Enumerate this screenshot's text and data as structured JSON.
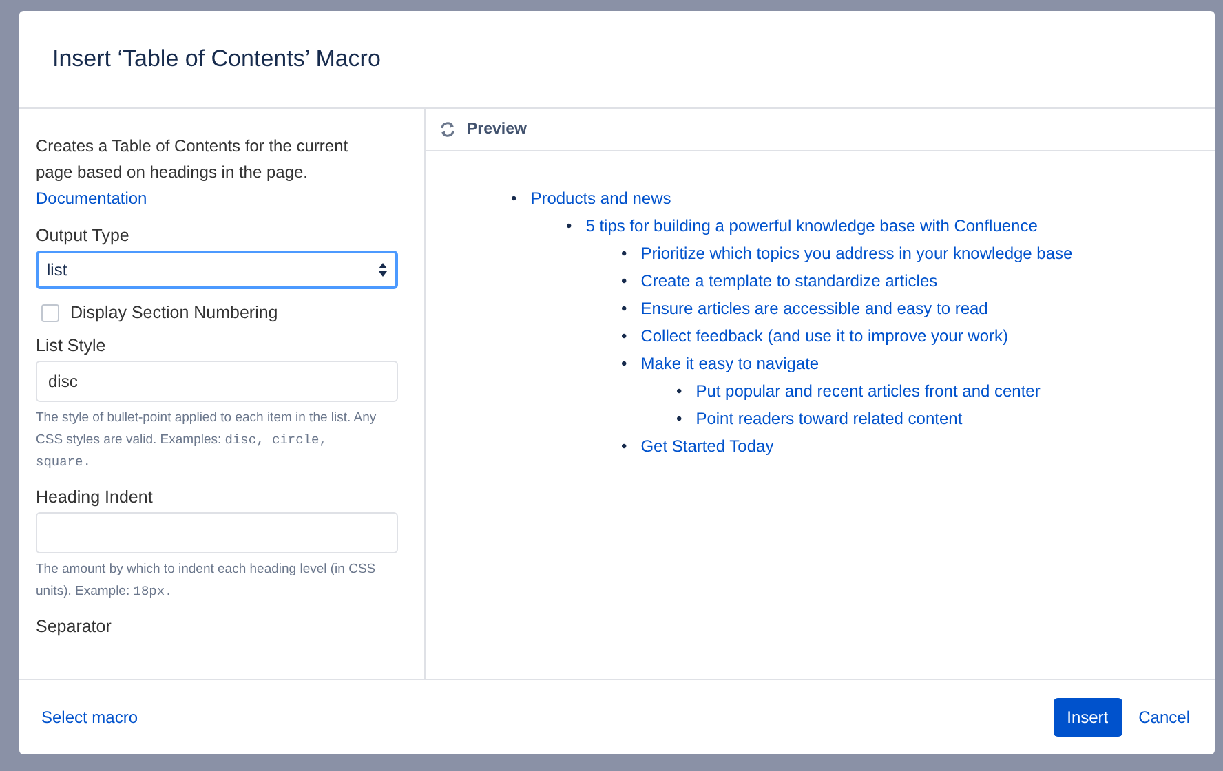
{
  "dialog": {
    "title": "Insert ‘Table of Contents’ Macro"
  },
  "options": {
    "description": "Creates a Table of Contents for the current page based on headings in the page.",
    "doc_link": "Documentation",
    "fields": [
      {
        "kind": "select",
        "label": "Output Type",
        "value": "list"
      },
      {
        "kind": "checkbox",
        "label": "Display Section Numbering",
        "checked": false
      },
      {
        "kind": "text",
        "label": "List Style",
        "value": "disc",
        "help": "The style of bullet-point applied to each item in the list. Any CSS styles are valid. Examples: ",
        "help_code": "disc, circle, square."
      },
      {
        "kind": "text",
        "label": "Heading Indent",
        "help": "The amount by which to indent each heading level (in CSS units). Example: ",
        "help_code": "18px."
      },
      {
        "kind": "heading",
        "label": "Separator"
      }
    ]
  },
  "preview": {
    "title": "Preview",
    "items": [
      {
        "marker": "•",
        "text": "Products and news",
        "children": [
          {
            "marker": "•",
            "text": "5 tips for building a powerful knowledge base with Confluence",
            "children": [
              {
                "marker": "•",
                "text": "Prioritize which topics you address in your knowledge base"
              },
              {
                "marker": "•",
                "text": "Create a template to standardize articles"
              },
              {
                "marker": "•",
                "text": "Ensure articles are accessible and easy to read"
              },
              {
                "marker": "•",
                "text": "Collect feedback (and use it to improve your work)"
              },
              {
                "marker": "•",
                "text": "Make it easy to navigate",
                "children": [
                  {
                    "marker": "•",
                    "text": "Put popular and recent articles front and center"
                  },
                  {
                    "marker": "•",
                    "text": "Point readers toward related content"
                  }
                ]
              },
              {
                "marker": "•",
                "text": "Get Started Today"
              }
            ]
          }
        ]
      }
    ]
  },
  "footer": {
    "select_macro": "Select macro",
    "buttons": [
      {
        "label": "Insert",
        "kind": "primary"
      },
      {
        "label": "Cancel",
        "kind": "link"
      }
    ]
  }
}
